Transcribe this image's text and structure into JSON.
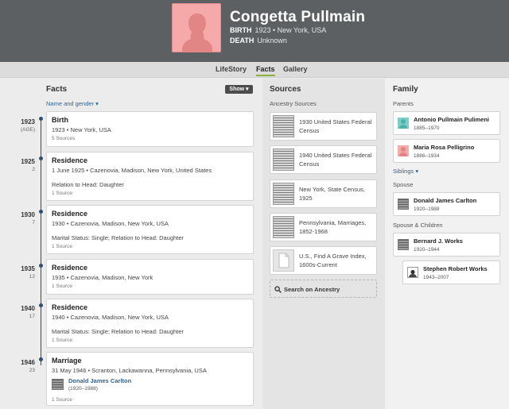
{
  "person": {
    "name": "Congetta Pullmain",
    "birth_label": "BIRTH",
    "birth_value": "1923 • New York, USA",
    "death_label": "DEATH",
    "death_value": "Unknown"
  },
  "tabs": [
    {
      "label": "LifeStory"
    },
    {
      "label": "Facts"
    },
    {
      "label": "Gallery"
    }
  ],
  "facts": {
    "title": "Facts",
    "show_label": "Show",
    "filter_link": "Name and gender",
    "timeline": [
      {
        "year": "1923",
        "age": "(AGE)"
      },
      {
        "year": "1925",
        "age": "2"
      },
      {
        "year": "1930",
        "age": "7"
      },
      {
        "year": "1935",
        "age": "12"
      },
      {
        "year": "1940",
        "age": "17"
      },
      {
        "year": "1946",
        "age": "23"
      }
    ],
    "cards": [
      {
        "title": "Birth",
        "detail": "1923 • New York, USA",
        "extra": "",
        "sources": "5 Sources"
      },
      {
        "title": "Residence",
        "detail": "1 June 1925 • Cazenovia, Madison, New York, United States",
        "extra": "Relation to Head: Daughter",
        "sources": "1 Source"
      },
      {
        "title": "Residence",
        "detail": "1930 • Cazenovia, Madison, New York, USA",
        "extra": "Marital Status: Single; Relation to Head: Daughter",
        "sources": "1 Source"
      },
      {
        "title": "Residence",
        "detail": "1935 • Cazenovia, Madison, New York",
        "extra": "",
        "sources": "1 Source"
      },
      {
        "title": "Residence",
        "detail": "1940 • Cazenovia, Madison, New York, USA",
        "extra": "Marital Status: Single; Relation to Head: Daughter",
        "sources": "1 Source"
      },
      {
        "title": "Marriage",
        "detail": "31 May 1946 • Scranton, Lackawanna, Pennsylvania, USA",
        "spouse_name": "Donald James Carlton",
        "spouse_dates": "(1920–1988)",
        "sources": "1 Source"
      }
    ]
  },
  "sources": {
    "title": "Sources",
    "subtitle": "Ancestry Sources",
    "items": [
      {
        "label": "1930 United States Federal Census",
        "thumb": "document"
      },
      {
        "label": "1940 United States Federal Census",
        "thumb": "document"
      },
      {
        "label": "New York, State Census, 1925",
        "thumb": "document"
      },
      {
        "label": "Pennsylvania, Marriages, 1852-1968",
        "thumb": "document"
      },
      {
        "label": "U.S., Find A Grave Index, 1600s-Current",
        "thumb": "blank-page"
      }
    ],
    "search_label": "Search on Ancestry"
  },
  "family": {
    "title": "Family",
    "parents_label": "Parents",
    "parents": [
      {
        "name": "Antonio Pullmain Pulimeni",
        "dates": "1885–1970",
        "icon": "male-silhouette-icon",
        "color": "#7ccfc9"
      },
      {
        "name": "Maria Rosa Pelligrino",
        "dates": "1886–1934",
        "icon": "female-silhouette-icon",
        "color": "#f5a9a8"
      }
    ],
    "siblings_label": "Siblings",
    "spouse_label": "Spouse",
    "spouse": {
      "name": "Donald James Carlton",
      "dates": "1920–1988"
    },
    "spouse_children_label": "Spouse & Children",
    "spouse2": {
      "name": "Bernard J. Works",
      "dates": "1920–1944"
    },
    "child": {
      "name": "Stephen Robert Works",
      "dates": "1943–2007"
    }
  },
  "colors": {
    "header_bg": "#5d6063",
    "active_tab_underline": "#8bb13a",
    "link": "#31638f",
    "timeline": "#2b4f73",
    "female_avatar": "#f5a9a8"
  }
}
